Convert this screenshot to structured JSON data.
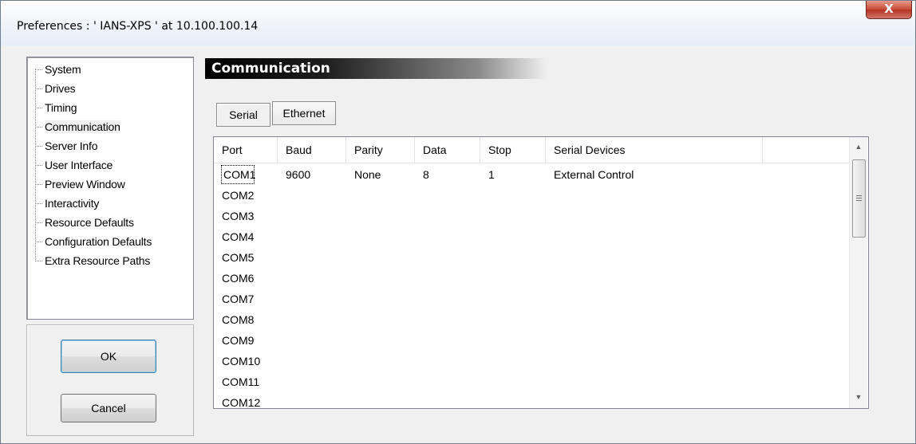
{
  "window": {
    "title": "Preferences  :  ' IANS-XPS '  at  10.100.100.14",
    "close_label": "X"
  },
  "tree": {
    "items": [
      {
        "label": "System"
      },
      {
        "label": "Drives"
      },
      {
        "label": "Timing"
      },
      {
        "label": "Communication",
        "selected": true
      },
      {
        "label": "Server Info"
      },
      {
        "label": "User Interface"
      },
      {
        "label": "Preview Window"
      },
      {
        "label": "Interactivity"
      },
      {
        "label": "Resource Defaults"
      },
      {
        "label": "Configuration Defaults"
      },
      {
        "label": "Extra Resource Paths"
      }
    ]
  },
  "buttons": {
    "ok": "OK",
    "cancel": "Cancel"
  },
  "section": {
    "title": "Communication"
  },
  "tabs": {
    "serial": "Serial",
    "ethernet": "Ethernet",
    "active": "Serial"
  },
  "table": {
    "columns": [
      "Port",
      "Baud",
      "Parity",
      "Data",
      "Stop",
      "Serial Devices"
    ],
    "rows": [
      [
        "COM1",
        "9600",
        "None",
        "8",
        "1",
        "External Control"
      ],
      [
        "COM2",
        "",
        "",
        "",
        "",
        ""
      ],
      [
        "COM3",
        "",
        "",
        "",
        "",
        ""
      ],
      [
        "COM4",
        "",
        "",
        "",
        "",
        ""
      ],
      [
        "COM5",
        "",
        "",
        "",
        "",
        ""
      ],
      [
        "COM6",
        "",
        "",
        "",
        "",
        ""
      ],
      [
        "COM7",
        "",
        "",
        "",
        "",
        ""
      ],
      [
        "COM8",
        "",
        "",
        "",
        "",
        ""
      ],
      [
        "COM9",
        "",
        "",
        "",
        "",
        ""
      ],
      [
        "COM10",
        "",
        "",
        "",
        "",
        ""
      ],
      [
        "COM11",
        "",
        "",
        "",
        "",
        ""
      ],
      [
        "COM12",
        "",
        "",
        "",
        "",
        ""
      ]
    ]
  },
  "scrollbar": {
    "up_icon": "scroll-up-arrow-icon",
    "down_icon": "scroll-down-arrow-icon"
  }
}
